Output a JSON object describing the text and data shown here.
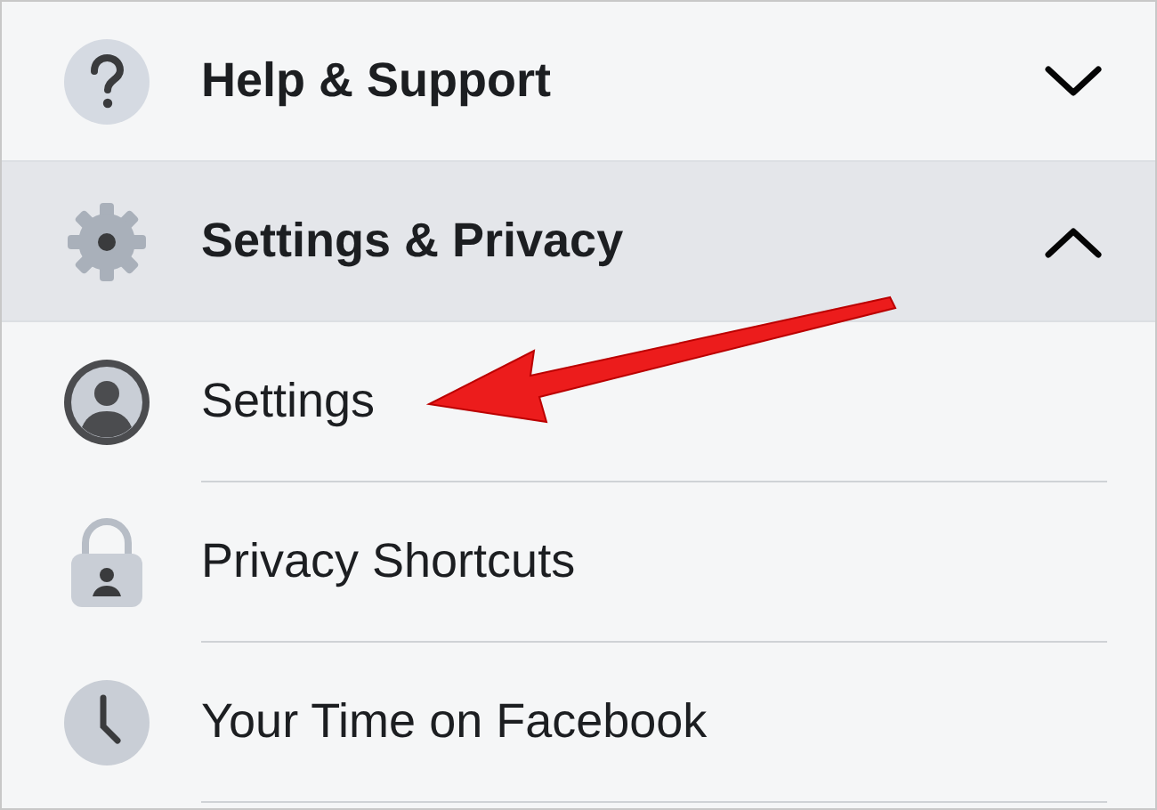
{
  "sections": [
    {
      "label": "Help & Support",
      "expanded": false
    },
    {
      "label": "Settings & Privacy",
      "expanded": true,
      "items": [
        {
          "label": "Settings"
        },
        {
          "label": "Privacy Shortcuts"
        },
        {
          "label": "Your Time on Facebook"
        }
      ]
    }
  ]
}
